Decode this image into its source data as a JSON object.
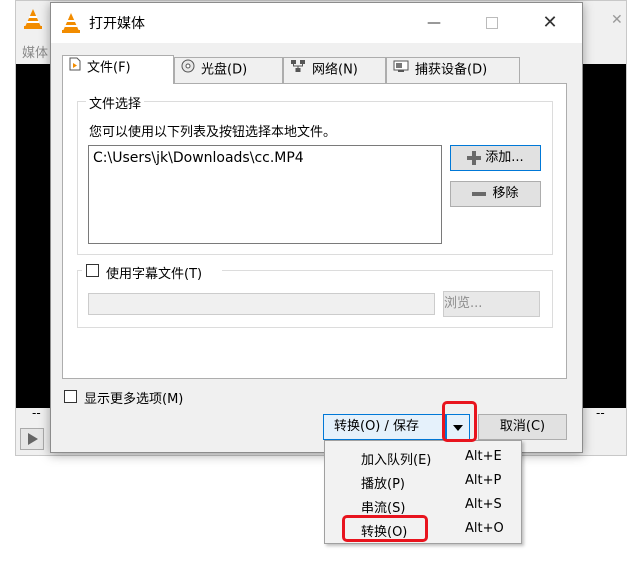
{
  "background_window": {
    "menu_partial": "媒体",
    "time_left": "--",
    "time_right": "--"
  },
  "dialog": {
    "title": "打开媒体",
    "tabs": [
      {
        "label": "文件(F)",
        "icon": "file-icon"
      },
      {
        "label": "光盘(D)",
        "icon": "disc-icon"
      },
      {
        "label": "网络(N)",
        "icon": "network-icon"
      },
      {
        "label": "捕获设备(D)",
        "icon": "capture-device-icon"
      }
    ],
    "file_selection": {
      "legend": "文件选择",
      "description": "您可以使用以下列表及按钮选择本地文件。",
      "files": [
        "C:\\Users\\jk\\Downloads\\cc.MP4"
      ],
      "add_label": "添加...",
      "remove_label": "移除"
    },
    "subtitle": {
      "checkbox_label": "使用字幕文件(T)",
      "checked": false,
      "browse_label": "浏览..."
    },
    "show_more": {
      "label": "显示更多选项(M)",
      "checked": false
    },
    "convert_save_label": "转换(O) / 保存",
    "cancel_label": "取消(C)"
  },
  "dropdown_menu": {
    "items": [
      {
        "label": "加入队列(E)",
        "shortcut": "Alt+E"
      },
      {
        "label": "播放(P)",
        "shortcut": "Alt+P"
      },
      {
        "label": "串流(S)",
        "shortcut": "Alt+S"
      },
      {
        "label": "转换(O)",
        "shortcut": "Alt+O"
      }
    ]
  },
  "colors": {
    "highlight": "#e8141e",
    "vlc_orange": "#f28c00",
    "focus_blue": "#0078d7"
  }
}
